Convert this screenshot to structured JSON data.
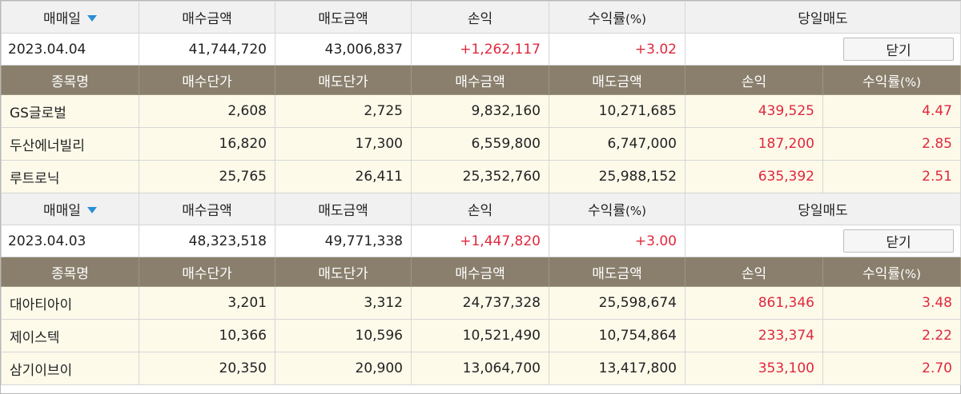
{
  "summary_headers": {
    "date": "매매일",
    "buy_amount": "매수금액",
    "sell_amount": "매도금액",
    "pnl": "손익",
    "return_rate": "수익률",
    "return_unit": "(%)",
    "sell_today": "당일매도"
  },
  "detail_headers": {
    "name": "종목명",
    "buy_price": "매수단가",
    "sell_price": "매도단가",
    "buy_amount": "매수금액",
    "sell_amount": "매도금액",
    "pnl": "손익",
    "return_rate": "수익률",
    "return_unit": "(%)"
  },
  "close_label": "닫기",
  "days": [
    {
      "date": "2023.04.04",
      "buy_amount": "41,744,720",
      "sell_amount": "43,006,837",
      "pnl": "+1,262,117",
      "return_rate": "+3.02",
      "stocks": [
        {
          "name": "GS글로벌",
          "buy_price": "2,608",
          "sell_price": "2,725",
          "buy_amount": "9,832,160",
          "sell_amount": "10,271,685",
          "pnl": "439,525",
          "return_rate": "4.47"
        },
        {
          "name": "두산에너빌리",
          "buy_price": "16,820",
          "sell_price": "17,300",
          "buy_amount": "6,559,800",
          "sell_amount": "6,747,000",
          "pnl": "187,200",
          "return_rate": "2.85"
        },
        {
          "name": "루트로닉",
          "buy_price": "25,765",
          "sell_price": "26,411",
          "buy_amount": "25,352,760",
          "sell_amount": "25,988,152",
          "pnl": "635,392",
          "return_rate": "2.51"
        }
      ]
    },
    {
      "date": "2023.04.03",
      "buy_amount": "48,323,518",
      "sell_amount": "49,771,338",
      "pnl": "+1,447,820",
      "return_rate": "+3.00",
      "stocks": [
        {
          "name": "대아티아이",
          "buy_price": "3,201",
          "sell_price": "3,312",
          "buy_amount": "24,737,328",
          "sell_amount": "25,598,674",
          "pnl": "861,346",
          "return_rate": "3.48"
        },
        {
          "name": "제이스텍",
          "buy_price": "10,366",
          "sell_price": "10,596",
          "buy_amount": "10,521,490",
          "sell_amount": "10,754,864",
          "pnl": "233,374",
          "return_rate": "2.22"
        },
        {
          "name": "삼기이브이",
          "buy_price": "20,350",
          "sell_price": "20,900",
          "buy_amount": "13,064,700",
          "sell_amount": "13,417,800",
          "pnl": "353,100",
          "return_rate": "2.70"
        }
      ]
    }
  ],
  "colors": {
    "profit": "#e0283c",
    "header_bg": "#8a7f6d",
    "row_bg": "#fdfaea",
    "sort_icon": "#2a8fd6"
  }
}
